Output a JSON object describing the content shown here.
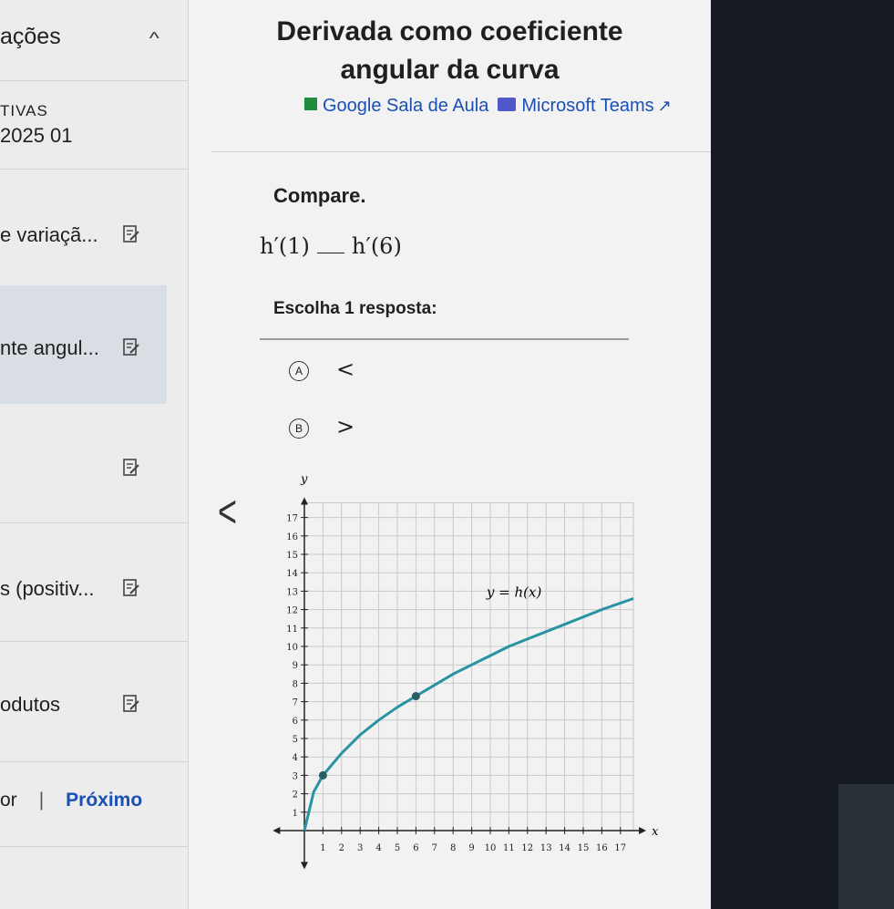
{
  "sidebar": {
    "header_title": "ações",
    "category": "TIVAS",
    "unit": "2025 01",
    "items": [
      {
        "label": "e variaçã..."
      },
      {
        "label": "nte angul..."
      },
      {
        "label": ""
      },
      {
        "label": "s (positiv..."
      },
      {
        "label": "odutos"
      }
    ],
    "prev_label": "or",
    "next_label": "Próximo"
  },
  "content": {
    "title_line1": "Derivada como coeficiente",
    "title_line2": "angular da curva",
    "google_link": "Google Sala de Aula",
    "teams_link": "Microsoft Teams",
    "compare_label": "Compare.",
    "expr_left": "h′(1)",
    "expr_right": "h′(6)",
    "choose_label": "Escolha 1 resposta:",
    "options": [
      {
        "letter": "A",
        "symbol": "<"
      },
      {
        "letter": "B",
        "symbol": ">"
      }
    ]
  },
  "icons": {
    "chevron": "chevron-up-icon",
    "external": "external-link-icon",
    "edit": "edit-note-icon",
    "back": "chevron-left-icon"
  },
  "colors": {
    "curve": "#2a93a3",
    "point": "#2b5b63",
    "link": "#1a4fb5"
  },
  "chart_data": {
    "type": "line",
    "x_axis_label": "x",
    "y_axis_label": "y",
    "curve_label": "y = h(x)",
    "xlim": [
      0,
      17.7
    ],
    "ylim": [
      0,
      17.8
    ],
    "x_ticks": [
      1,
      2,
      3,
      4,
      5,
      6,
      7,
      8,
      9,
      10,
      11,
      12,
      13,
      14,
      15,
      16,
      17
    ],
    "y_ticks": [
      1,
      2,
      3,
      4,
      5,
      6,
      7,
      8,
      9,
      10,
      11,
      12,
      13,
      14,
      15,
      16,
      17
    ],
    "grid": true,
    "curve": {
      "x": [
        0,
        0.5,
        1,
        2,
        3,
        4,
        5,
        6,
        7,
        8,
        9,
        10,
        11,
        12,
        13,
        14,
        15,
        16,
        17.7
      ],
      "y": [
        0,
        2.1,
        3,
        4.2,
        5.2,
        6,
        6.7,
        7.3,
        7.9,
        8.5,
        9,
        9.5,
        10,
        10.4,
        10.8,
        11.2,
        11.6,
        12,
        12.6
      ]
    },
    "points": [
      {
        "x": 1,
        "y": 3
      },
      {
        "x": 6,
        "y": 7.3
      }
    ]
  }
}
